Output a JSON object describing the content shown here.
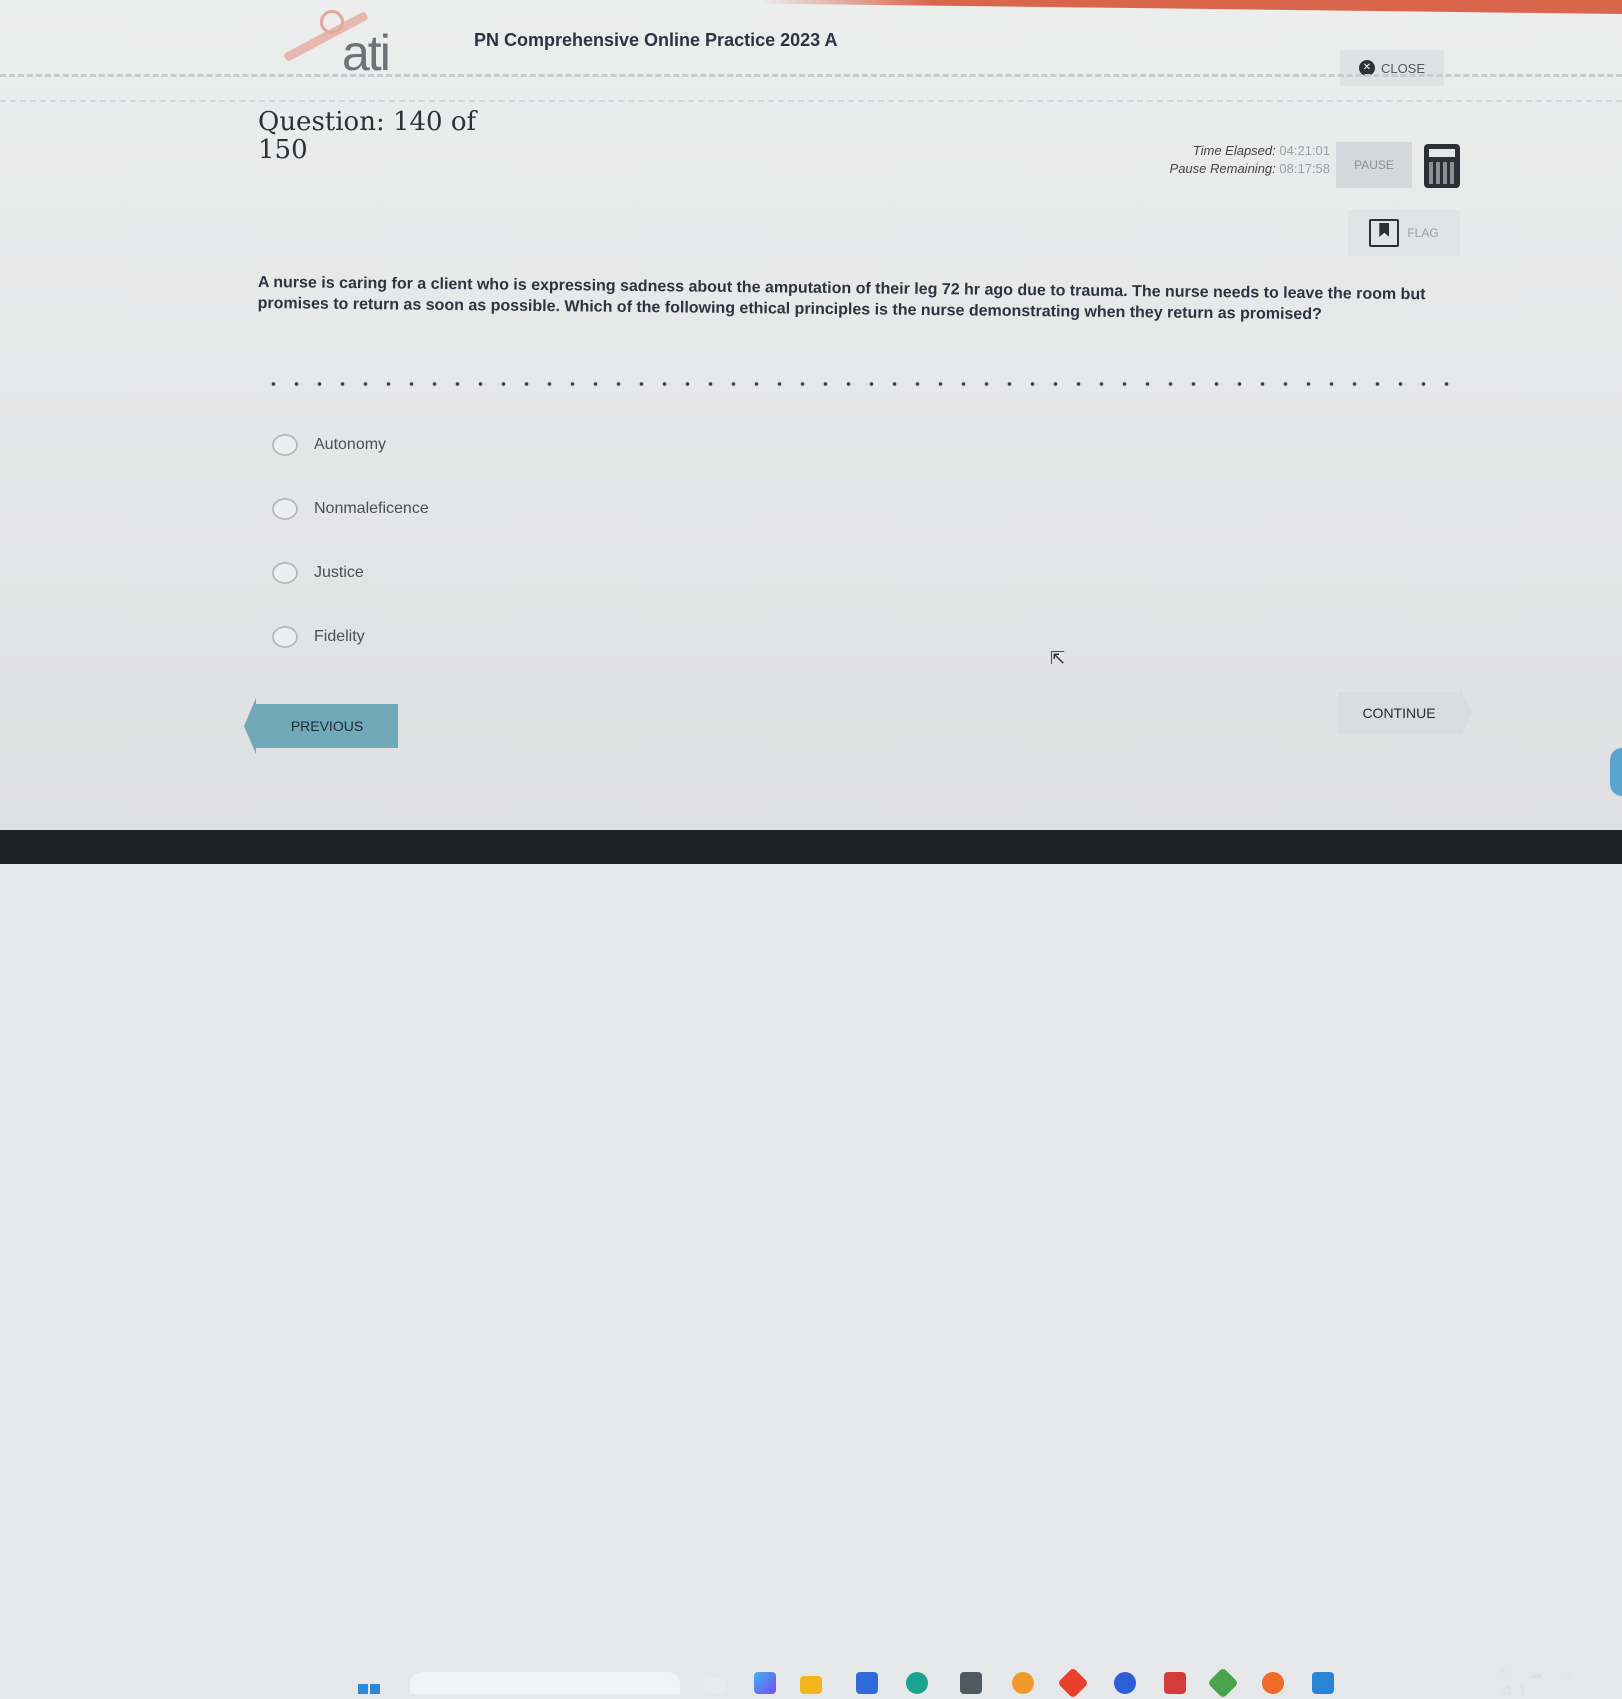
{
  "app": {
    "logo_text": "ati",
    "title": "PN Comprehensive Online Practice 2023 A",
    "close_label": "CLOSE"
  },
  "question": {
    "number_label": "Question: 140 of 150",
    "stem": "A nurse is caring for a client who is expressing sadness about the amputation of their leg 72 hr ago due to trauma. The nurse needs to leave the room but promises to return as soon as possible. Which of the following ethical principles is the nurse demonstrating when they return as promised?",
    "options": [
      "Autonomy",
      "Nonmaleficence",
      "Justice",
      "Fidelity"
    ]
  },
  "timer": {
    "elapsed_label": "Time Elapsed:",
    "elapsed_value": "04:21:01",
    "pause_label": "Pause Remaining:",
    "pause_value": "08:17:58"
  },
  "controls": {
    "pause": "PAUSE",
    "flag": "FLAG",
    "previous": "PREVIOUS",
    "continue": "CONTINUE"
  },
  "colors": {
    "accent_teal": "#6fa9b8",
    "header_red": "#d9654a"
  }
}
